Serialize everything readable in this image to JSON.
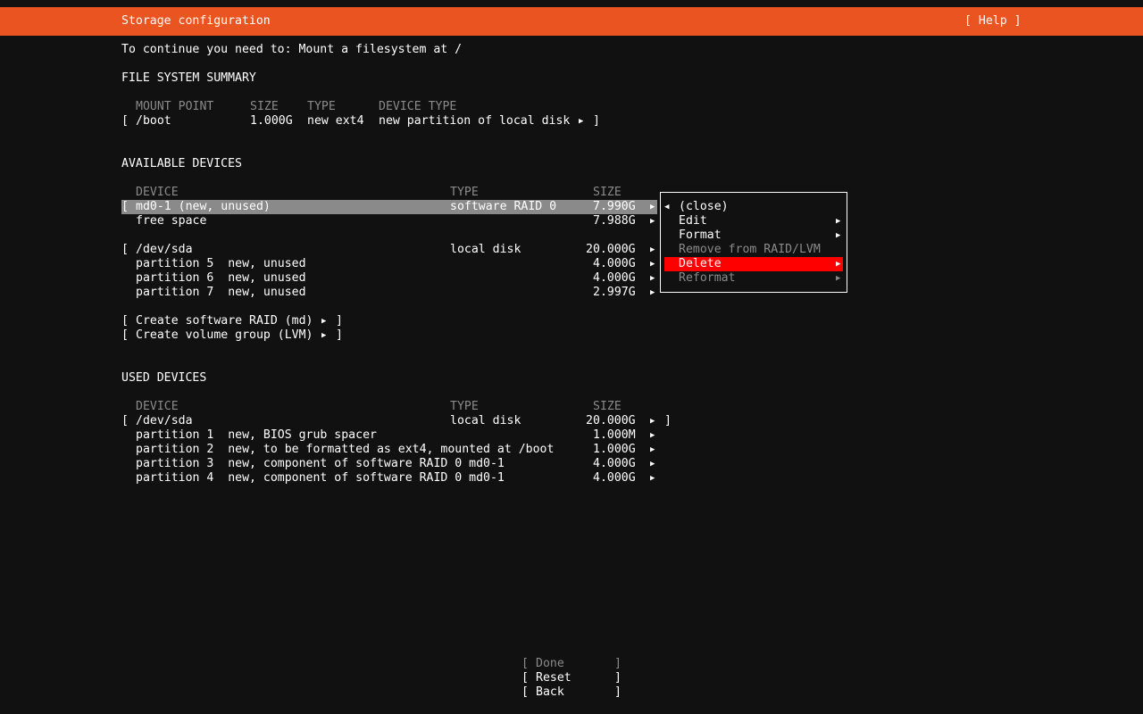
{
  "header": {
    "title": "Storage configuration",
    "help": "[ Help ]",
    "color": "#e95420"
  },
  "instruction": "To continue you need to: Mount a filesystem at /",
  "fs_summary": {
    "heading": "FILE SYSTEM SUMMARY",
    "columns": [
      "MOUNT POINT",
      "SIZE",
      "TYPE",
      "DEVICE TYPE"
    ],
    "rows": [
      {
        "mount": "/boot",
        "size": "1.000G",
        "type": "new ext4",
        "device_type": "new partition of local disk"
      }
    ]
  },
  "available": {
    "heading": "AVAILABLE DEVICES",
    "columns": [
      "DEVICE",
      "TYPE",
      "SIZE"
    ],
    "rows": [
      {
        "device": "md0-1 (new, unused)",
        "type": "software RAID 0",
        "size": "7.990G",
        "selected": true
      },
      {
        "device": "free space",
        "type": "",
        "size": "7.988G"
      },
      {
        "device": "/dev/sda",
        "type": "local disk",
        "size": "20.000G"
      },
      {
        "device": "partition 5  new, unused",
        "type": "",
        "size": "4.000G"
      },
      {
        "device": "partition 6  new, unused",
        "type": "",
        "size": "4.000G"
      },
      {
        "device": "partition 7  new, unused",
        "type": "",
        "size": "2.997G"
      }
    ],
    "create_raid": "Create software RAID (md)",
    "create_lvm": "Create volume group (LVM)"
  },
  "context_menu": {
    "items": [
      {
        "label": "(close)",
        "enabled": true
      },
      {
        "label": "Edit",
        "enabled": true
      },
      {
        "label": "Format",
        "enabled": true
      },
      {
        "label": "Remove from RAID/LVM",
        "enabled": false
      },
      {
        "label": "Delete",
        "enabled": true,
        "selected": true
      },
      {
        "label": "Reformat",
        "enabled": false
      }
    ],
    "highlight_color": "#ff0000"
  },
  "used": {
    "heading": "USED DEVICES",
    "columns": [
      "DEVICE",
      "TYPE",
      "SIZE"
    ],
    "rows": [
      {
        "device": "/dev/sda",
        "type": "local disk",
        "size": "20.000G"
      },
      {
        "device": "partition 1  new, BIOS grub spacer",
        "type": "",
        "size": "1.000M"
      },
      {
        "device": "partition 2  new, to be formatted as ext4, mounted at /boot",
        "type": "",
        "size": "1.000G"
      },
      {
        "device": "partition 3  new, component of software RAID 0 md0-1",
        "type": "",
        "size": "4.000G"
      },
      {
        "device": "partition 4  new, component of software RAID 0 md0-1",
        "type": "",
        "size": "4.000G"
      }
    ]
  },
  "buttons": {
    "done": "Done",
    "reset": "Reset",
    "back": "Back"
  },
  "glyphs": {
    "open": "[",
    "close": "]",
    "right_arrow": "▶",
    "left_arrow": "◀"
  }
}
